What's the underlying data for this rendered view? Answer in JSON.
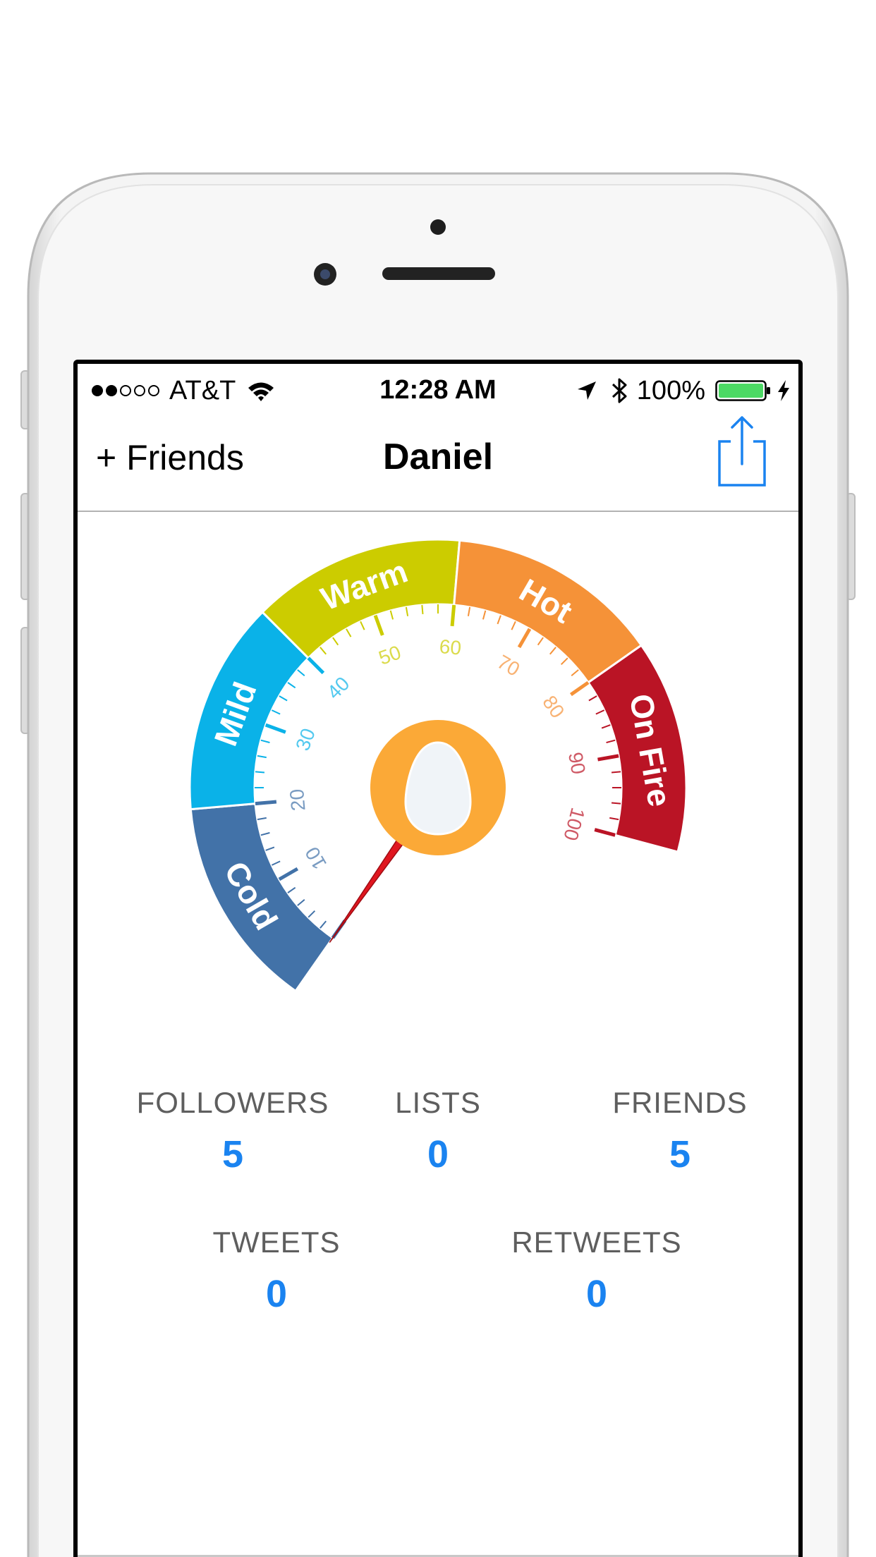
{
  "status_bar": {
    "signal_filled": 2,
    "signal_total": 5,
    "carrier": "AT&T",
    "time": "12:28 AM",
    "battery_percent": "100%",
    "battery_level": 1.0,
    "icons": [
      "wifi-icon",
      "location-arrow-icon",
      "bluetooth-icon",
      "battery-icon",
      "charging-bolt-icon"
    ]
  },
  "nav": {
    "left_button": "+ Friends",
    "title": "Daniel",
    "right_icon": "share-icon"
  },
  "gauge": {
    "value": 0,
    "min": 0,
    "max": 100,
    "bands": [
      {
        "label": "Cold",
        "from": 0,
        "to": 20,
        "color": "#4272a8"
      },
      {
        "label": "Mild",
        "from": 20,
        "to": 40,
        "color": "#0ab2e8"
      },
      {
        "label": "Warm",
        "from": 40,
        "to": 60,
        "color": "#cccc00"
      },
      {
        "label": "Hot",
        "from": 60,
        "to": 80,
        "color": "#f59238"
      },
      {
        "label": "On Fire",
        "from": 80,
        "to": 100,
        "color": "#ba1425"
      }
    ],
    "tick_labels": [
      "10",
      "20",
      "30",
      "40",
      "50",
      "60",
      "70",
      "80",
      "90",
      "100"
    ],
    "needle_color": "#e0161f",
    "hub_color": "#fba937",
    "hub_icon": "egg-avatar-icon"
  },
  "stats": {
    "followers": {
      "label": "FOLLOWERS",
      "value": "5"
    },
    "lists": {
      "label": "LISTS",
      "value": "0"
    },
    "friends": {
      "label": "FRIENDS",
      "value": "5"
    },
    "tweets": {
      "label": "TWEETS",
      "value": "0"
    },
    "retweets": {
      "label": "RETWEETS",
      "value": "0"
    }
  },
  "colors": {
    "accent": "#1a83f0",
    "label_gray": "#5e5e5e"
  }
}
